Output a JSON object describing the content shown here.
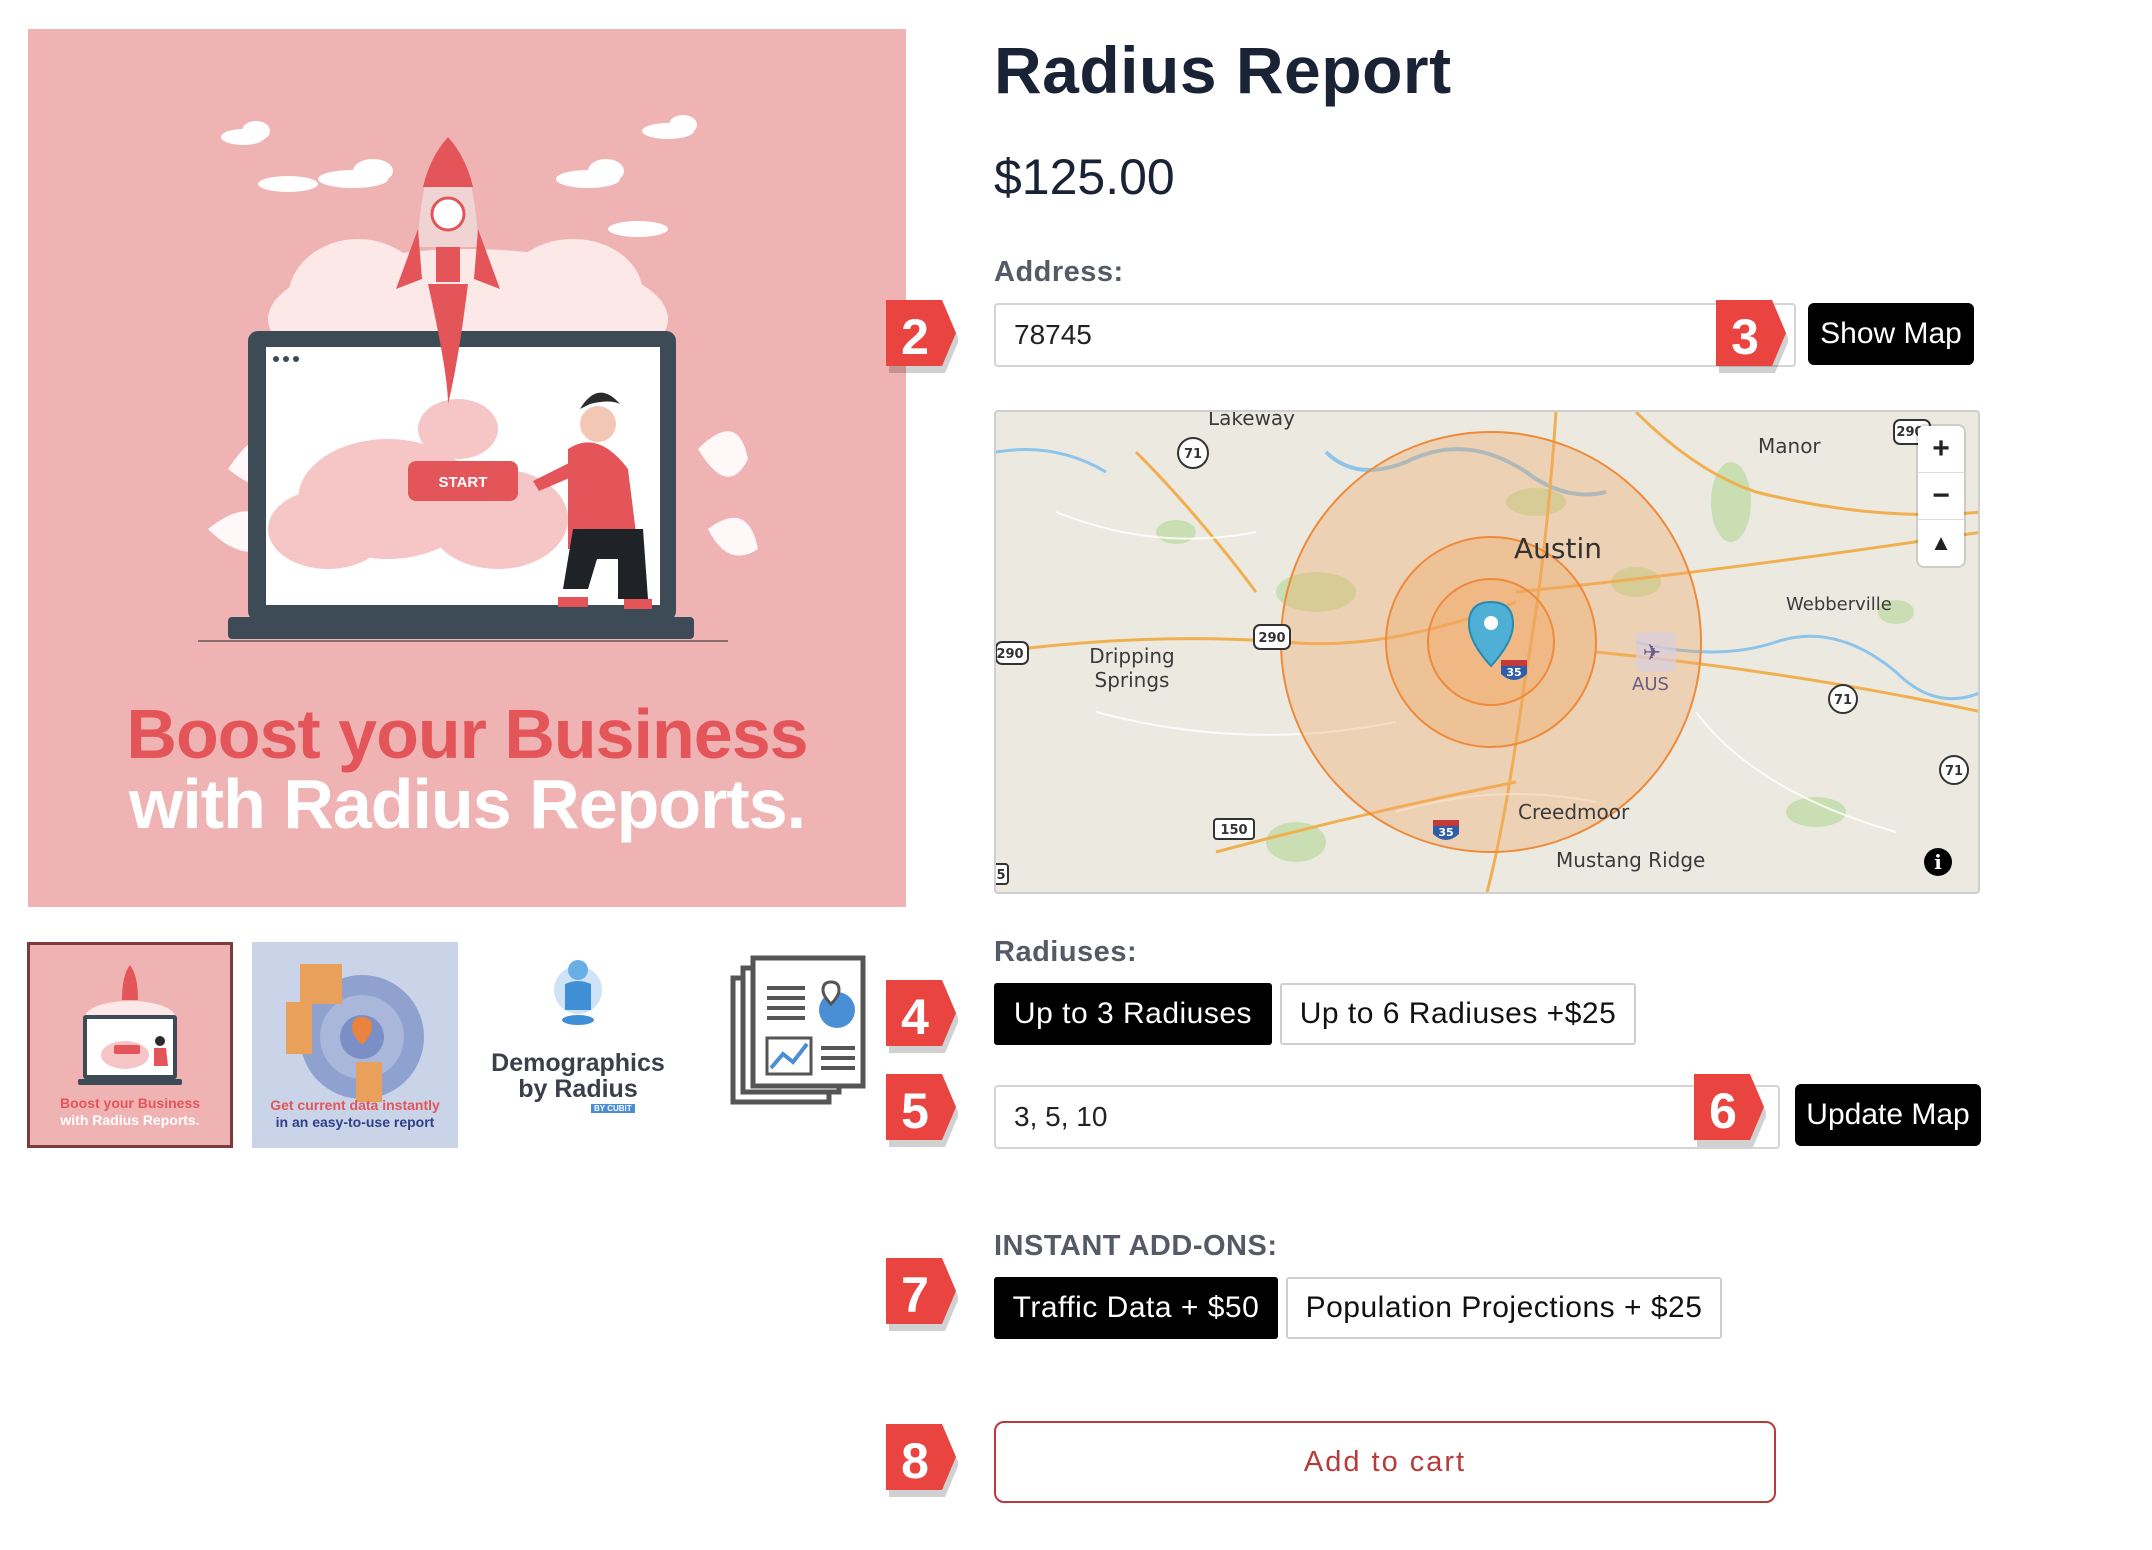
{
  "hero": {
    "line1": "Boost your Business",
    "line2": "with Radius Reports.",
    "start_label": "START"
  },
  "thumbnails": {
    "t1_line1": "Boost your Business",
    "t1_line2": "with Radius Reports.",
    "t2_line1": "Get current data instantly",
    "t2_line2": "in an easy-to-use report",
    "t3_line1": "Demographics",
    "t3_line2": "by Radius",
    "t3_tag": "BY CUBIT"
  },
  "product": {
    "title": "Radius Report",
    "price": "$125.00"
  },
  "address": {
    "label": "Address:",
    "value": "78745",
    "show_map_label": "Show Map"
  },
  "map": {
    "places": [
      "Lakeway",
      "Manor",
      "Austin",
      "Webberville",
      "Dripping Springs",
      "AUS",
      "Creedmoor",
      "Mustang Ridge"
    ],
    "shields": [
      "71",
      "290",
      "290",
      "290",
      "35",
      "35",
      "150",
      "71",
      "71",
      "5"
    ],
    "zoom_in": "+",
    "zoom_out": "−",
    "compass": "▲",
    "info": "i"
  },
  "radiuses": {
    "label": "Radiuses:",
    "options": [
      "Up to 3 Radiuses",
      "Up to 6 Radiuses +$25"
    ],
    "selected": "Up to 3 Radiuses",
    "value": "3, 5, 10",
    "update_label": "Update Map"
  },
  "addons": {
    "label": "INSTANT ADD-ONS:",
    "options": [
      "Traffic Data + $50",
      "Population Projections + $25"
    ],
    "selected": "Traffic Data + $50"
  },
  "cart": {
    "label": "Add to cart"
  },
  "badges": [
    "2",
    "3",
    "4",
    "5",
    "6",
    "7",
    "8"
  ],
  "colors": {
    "badge": "#e9443f",
    "button": "#000000",
    "cart_border": "#b83a3a",
    "hero_bg": "#efb3b3",
    "radius_fill": "#f0a560"
  }
}
